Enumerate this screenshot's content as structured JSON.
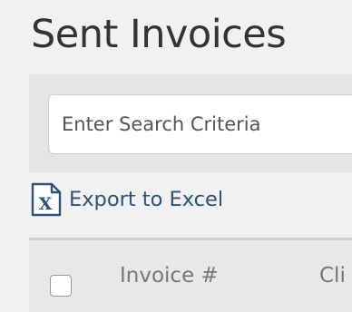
{
  "page": {
    "title": "Sent Invoices"
  },
  "search": {
    "placeholder": "Enter Search Criteria"
  },
  "export": {
    "icon": "excel-file-icon",
    "label": "Export to Excel",
    "icon_letter": "X"
  },
  "colors": {
    "title": "#333333",
    "link": "#2c5378",
    "panel": "#e5e5e5",
    "background": "#f1f1f1"
  },
  "table": {
    "columns": [
      {
        "label": "Invoice #"
      },
      {
        "label": "Cli"
      }
    ],
    "select_all_checked": false
  }
}
